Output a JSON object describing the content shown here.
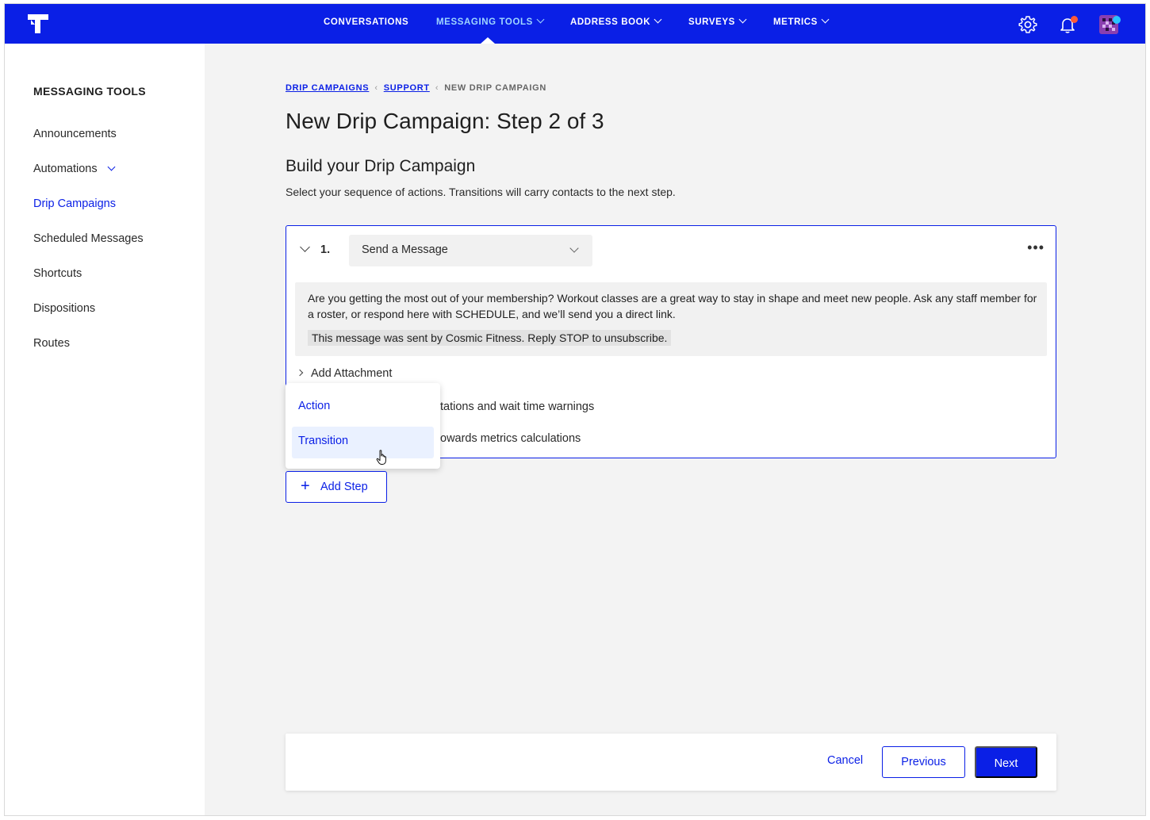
{
  "nav": {
    "items": [
      {
        "label": "CONVERSATIONS",
        "dropdown": false,
        "active": false
      },
      {
        "label": "MESSAGING TOOLS",
        "dropdown": true,
        "active": true
      },
      {
        "label": "ADDRESS BOOK",
        "dropdown": true,
        "active": false
      },
      {
        "label": "SURVEYS",
        "dropdown": true,
        "active": false
      },
      {
        "label": "METRICS",
        "dropdown": true,
        "active": false
      }
    ],
    "icons": [
      "gear-icon",
      "bell-icon",
      "avatar"
    ],
    "colors": {
      "bar": "#0a1fe6",
      "active": "#9fd6ff",
      "bell_dot": "#ff5a36",
      "avatar_dot": "#29c4ff"
    }
  },
  "sidebar": {
    "title": "MESSAGING TOOLS",
    "items": [
      {
        "label": "Announcements"
      },
      {
        "label": "Automations",
        "expandable": true
      },
      {
        "label": "Drip Campaigns",
        "active": true
      },
      {
        "label": "Scheduled Messages"
      },
      {
        "label": "Shortcuts"
      },
      {
        "label": "Dispositions"
      },
      {
        "label": "Routes"
      }
    ]
  },
  "breadcrumb": {
    "items": [
      "DRIP CAMPAIGNS",
      "SUPPORT"
    ],
    "current": "NEW DRIP CAMPAIGN"
  },
  "page": {
    "title": "New Drip Campaign: Step 2 of 3",
    "section_title": "Build your Drip Campaign",
    "section_desc": "Select your sequence of actions. Transitions will carry contacts to the next step."
  },
  "step": {
    "number": "1.",
    "action_value": "Send a Message",
    "message": "Are you getting the most out of your membership? Workout classes are a great way to stay in shape and meet new people. Ask any staff member for a roster, or respond here with SCHEDULE, and we’ll send you a direct link.",
    "footer": "This message was sent by Cosmic Fitness. Reply STOP to unsubscribe.",
    "add_attachment": "Add Attachment",
    "partial_option_1": "tations and wait time warnings",
    "partial_option_2": "owards metrics calculations"
  },
  "dropdown_menu": {
    "items": [
      "Action",
      "Transition"
    ],
    "hovered": "Transition"
  },
  "add_step_label": "Add Step",
  "footer_actions": {
    "cancel": "Cancel",
    "previous": "Previous",
    "next": "Next"
  }
}
